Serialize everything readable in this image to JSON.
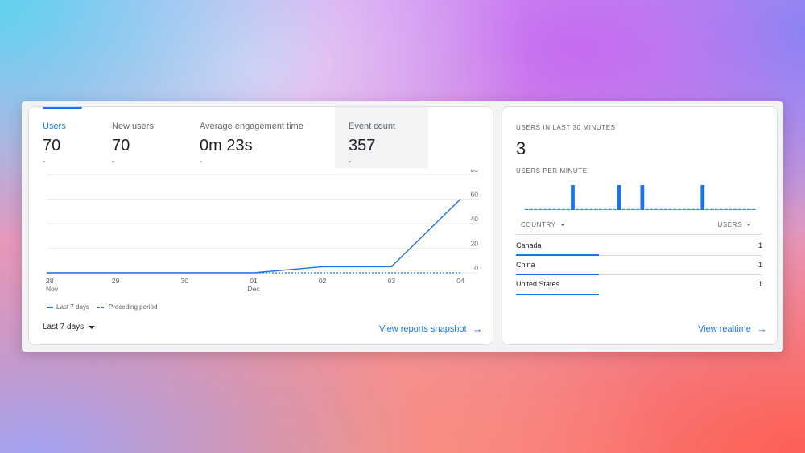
{
  "metrics": [
    {
      "label": "Users",
      "value": "70",
      "delta": "-"
    },
    {
      "label": "New users",
      "value": "70",
      "delta": "-"
    },
    {
      "label": "Average engagement time",
      "value": "0m 23s",
      "delta": "-"
    },
    {
      "label": "Event count",
      "value": "357",
      "delta": "-"
    }
  ],
  "chart_data": {
    "type": "line",
    "x": [
      "28 Nov",
      "29",
      "30",
      "01 Dec",
      "02",
      "03",
      "04"
    ],
    "x_tick_labels": [
      {
        "line1": "28",
        "line2": "Nov"
      },
      {
        "line1": "29",
        "line2": ""
      },
      {
        "line1": "30",
        "line2": ""
      },
      {
        "line1": "01",
        "line2": "Dec"
      },
      {
        "line1": "02",
        "line2": ""
      },
      {
        "line1": "03",
        "line2": ""
      },
      {
        "line1": "04",
        "line2": ""
      }
    ],
    "y_ticks": [
      "80",
      "60",
      "40",
      "20",
      "0"
    ],
    "ylim": [
      0,
      80
    ],
    "series": [
      {
        "name": "Last 7 days",
        "style": "solid",
        "color": "#1a73e8",
        "values": [
          0,
          0,
          0,
          0,
          5,
          5,
          60
        ]
      },
      {
        "name": "Preceding period",
        "style": "dashed",
        "color": "#1a73e8",
        "values": [
          0,
          0,
          0,
          0,
          0,
          0,
          0
        ]
      }
    ],
    "legend_position": "bottom-left",
    "grid": true
  },
  "legend": {
    "current": "Last 7 days",
    "previous": "Preceding period"
  },
  "date_range": {
    "label": "Last 7 days"
  },
  "links": {
    "reports": "View reports snapshot",
    "realtime": "View realtime"
  },
  "realtime": {
    "title": "USERS IN LAST 30 MINUTES",
    "value": "3",
    "per_minute_label": "USERS PER MINUTE",
    "per_minute": [
      0,
      0,
      0,
      0,
      0,
      0,
      0,
      0,
      0,
      0,
      1,
      0,
      0,
      0,
      0,
      0,
      0,
      0,
      0,
      0,
      1,
      0,
      0,
      0,
      0,
      1,
      0,
      0,
      0,
      0,
      0,
      0,
      0,
      0,
      0,
      0,
      0,
      0,
      1,
      0,
      0,
      0,
      0,
      0,
      0,
      0,
      0,
      0,
      0,
      0
    ],
    "table": {
      "col_country": "COUNTRY",
      "col_users": "USERS",
      "rows": [
        {
          "country": "Canada",
          "users": "1",
          "share": 1.0
        },
        {
          "country": "China",
          "users": "1",
          "share": 1.0
        },
        {
          "country": "United States",
          "users": "1",
          "share": 1.0
        }
      ]
    }
  },
  "colors": {
    "accent": "#1a73e8",
    "grid": "#e8eaed",
    "text": "#202124",
    "muted": "#5f6368"
  }
}
